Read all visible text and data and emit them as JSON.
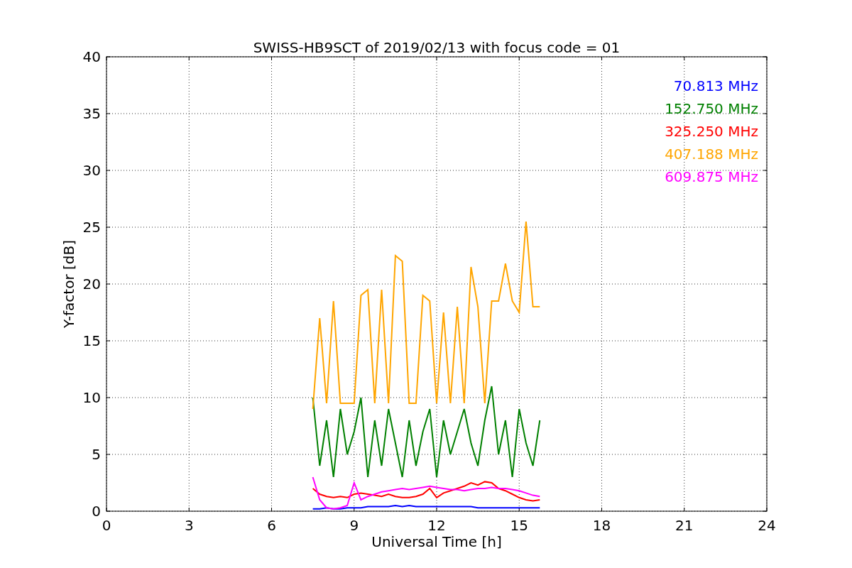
{
  "figure": {
    "chart_data": {
      "type": "line",
      "grid": true,
      "title": "SWISS-HB9SCT of 2019/02/13 with focus code = 01",
      "xlabel": "Universal Time [h]",
      "ylabel": "Y-factor [dB]",
      "xlim": [
        0,
        24
      ],
      "ylim": [
        0,
        40
      ],
      "xticks": [
        0,
        3,
        6,
        9,
        12,
        15,
        18,
        21,
        24
      ],
      "yticks": [
        0,
        5,
        10,
        15,
        20,
        25,
        30,
        35,
        40
      ],
      "x": [
        7.5,
        7.75,
        8,
        8.25,
        8.5,
        8.75,
        9,
        9.25,
        9.5,
        9.75,
        10,
        10.25,
        10.5,
        10.75,
        11,
        11.25,
        11.5,
        11.75,
        12,
        12.25,
        12.5,
        12.75,
        13,
        13.25,
        13.5,
        13.75,
        14,
        14.25,
        14.5,
        14.75,
        15,
        15.25,
        15.5,
        15.75
      ],
      "series": [
        {
          "name": "70.813 MHz",
          "color": "#0000ff",
          "values": [
            0.2,
            0.2,
            0.3,
            0.2,
            0.2,
            0.3,
            0.3,
            0.3,
            0.4,
            0.4,
            0.4,
            0.4,
            0.5,
            0.4,
            0.5,
            0.4,
            0.4,
            0.4,
            0.4,
            0.4,
            0.4,
            0.4,
            0.4,
            0.4,
            0.3,
            0.3,
            0.3,
            0.3,
            0.3,
            0.3,
            0.3,
            0.3,
            0.3,
            0.3
          ]
        },
        {
          "name": "152.750 MHz",
          "color": "#008000",
          "values": [
            10,
            4,
            8,
            3,
            9,
            5,
            7,
            10,
            3,
            8,
            4,
            9,
            6,
            3,
            8,
            4,
            7,
            9,
            3,
            8,
            5,
            7,
            9,
            6,
            4,
            8,
            11,
            5,
            8,
            3,
            9,
            6,
            4,
            8
          ]
        },
        {
          "name": "325.250 MHz",
          "color": "#ff0000",
          "values": [
            2,
            1.5,
            1.3,
            1.2,
            1.3,
            1.2,
            1.5,
            1.6,
            1.5,
            1.4,
            1.3,
            1.5,
            1.3,
            1.2,
            1.2,
            1.3,
            1.5,
            2,
            1.2,
            1.6,
            1.8,
            2,
            2.2,
            2.5,
            2.3,
            2.6,
            2.5,
            2,
            1.8,
            1.5,
            1.2,
            1,
            0.9,
            1
          ]
        },
        {
          "name": "407.188 MHz",
          "color": "#ffa500",
          "values": [
            9,
            17,
            9.5,
            18.5,
            9.5,
            9.5,
            9.5,
            19,
            19.5,
            9.5,
            19.5,
            9.5,
            22.5,
            22,
            9.5,
            9.5,
            19,
            18.5,
            9.5,
            17.5,
            9.5,
            18,
            9.5,
            21.5,
            18,
            9.5,
            18.5,
            18.5,
            21.8,
            18.5,
            17.5,
            25.5,
            18,
            18
          ]
        },
        {
          "name": "609.875 MHz",
          "color": "#ff00ff",
          "values": [
            3,
            1,
            0.3,
            0.2,
            0.3,
            0.5,
            2.5,
            1,
            1.3,
            1.5,
            1.7,
            1.8,
            1.9,
            2,
            1.9,
            2,
            2.1,
            2.2,
            2.1,
            2,
            1.9,
            1.9,
            1.8,
            1.9,
            2,
            2,
            2.1,
            2,
            2,
            1.9,
            1.8,
            1.6,
            1.4,
            1.3
          ]
        }
      ]
    }
  }
}
